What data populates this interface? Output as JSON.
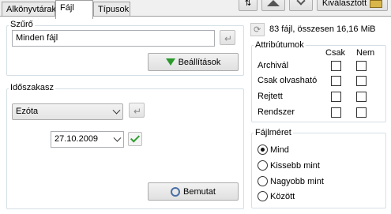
{
  "tabs": [
    {
      "label": "Alkönyvtárak"
    },
    {
      "label": "Fájl"
    },
    {
      "label": "Típusok"
    }
  ],
  "toolbar": {
    "tool_label": "Kiválasztott"
  },
  "filter": {
    "title": "Szűrő",
    "value": "Minden fájl",
    "settings_label": "Beállítások"
  },
  "period": {
    "title": "Időszakasz",
    "selected": "Ezóta",
    "date": "27.10.2009"
  },
  "show_label": "Bemutat",
  "summary": "83 fájl, összesen 16,16 MiB",
  "attributes": {
    "title": "Attribútumok",
    "col_yes": "Csak",
    "col_no": "Nem",
    "rows": [
      {
        "label": "Archivál"
      },
      {
        "label": "Csak olvasható"
      },
      {
        "label": "Rejtett"
      },
      {
        "label": "Rendszer"
      }
    ]
  },
  "filesize": {
    "title": "Fájlméret",
    "options": [
      {
        "label": "Mind",
        "selected": true
      },
      {
        "label": "Kissebb mint",
        "selected": false
      },
      {
        "label": "Nagyobb mint",
        "selected": false
      },
      {
        "label": "Között",
        "selected": false
      }
    ]
  },
  "colors": {
    "check_green": "#2e9e2e",
    "funnel_green": "#2a9a2a"
  }
}
